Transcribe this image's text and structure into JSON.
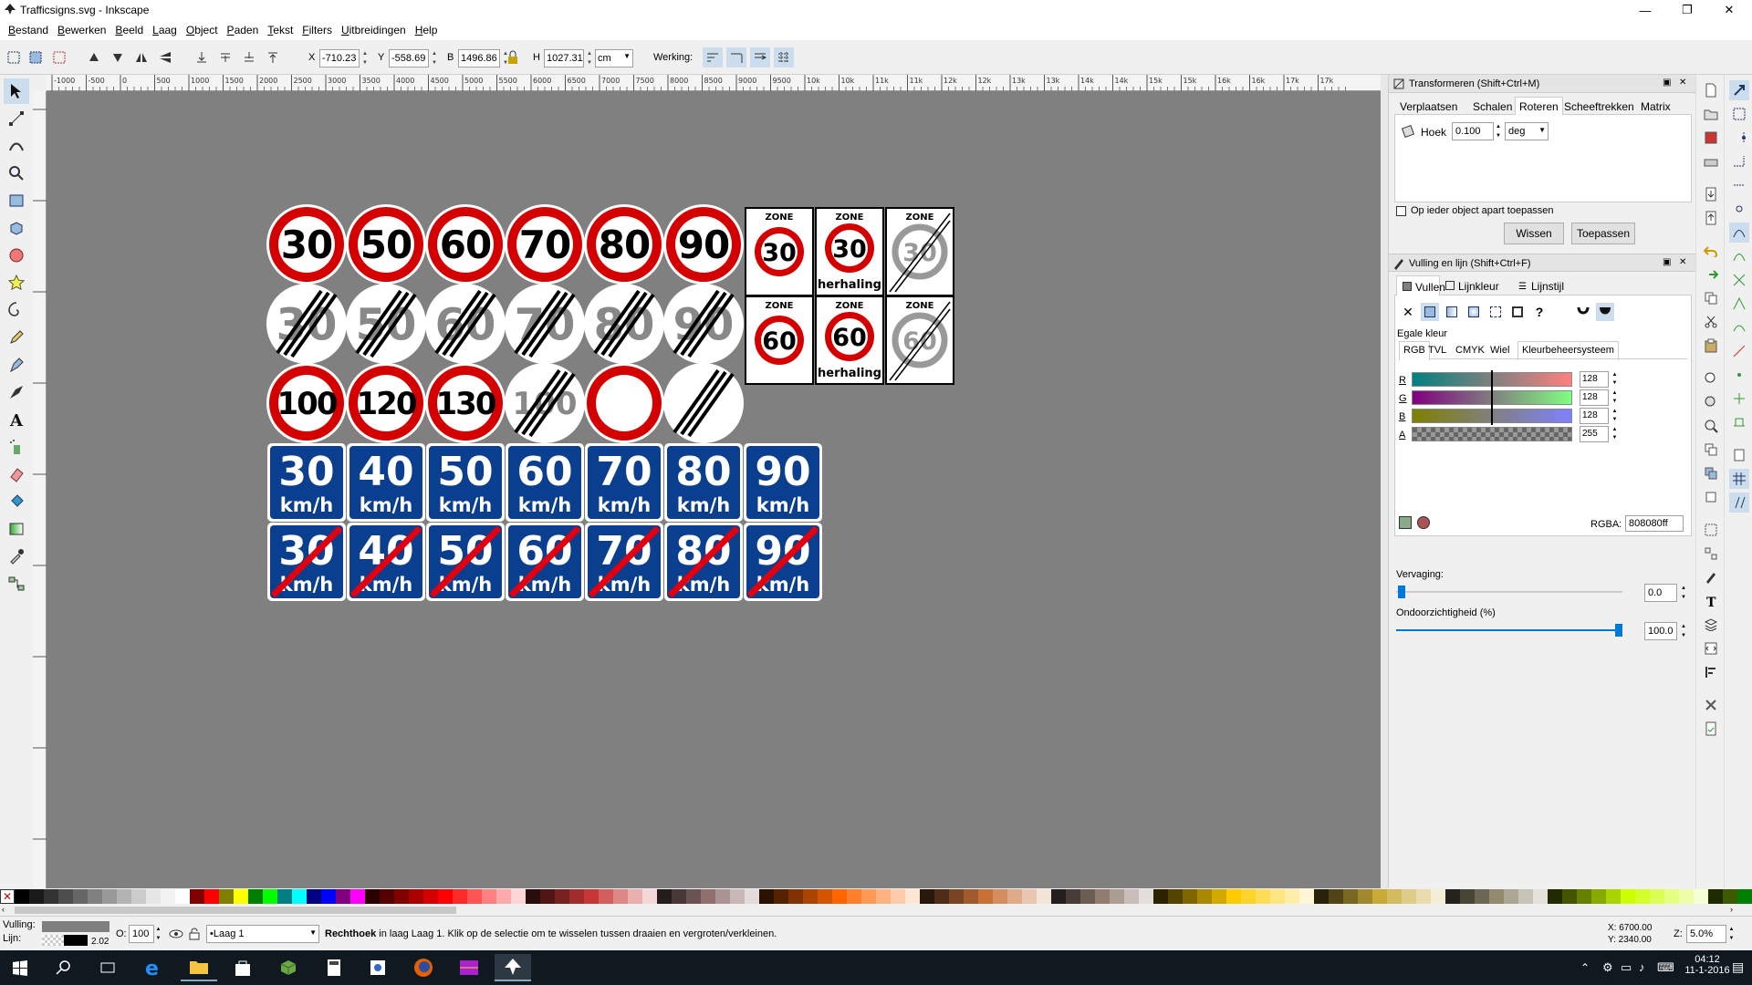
{
  "window": {
    "title": "Trafficsigns.svg - Inkscape",
    "minimize": "—",
    "maximize": "❐",
    "close": "✕"
  },
  "menu": [
    "Bestand",
    "Bewerken",
    "Beeld",
    "Laag",
    "Object",
    "Paden",
    "Tekst",
    "Filters",
    "Uitbreidingen",
    "Help"
  ],
  "toolcontrols": {
    "x_label": "X",
    "x_value": "-710.23",
    "y_label": "Y",
    "y_value": "-558.69",
    "w_label": "B",
    "w_value": "1496.86",
    "h_label": "H",
    "h_value": "1027.31",
    "unit": "cm",
    "affect_label": "Werking:"
  },
  "ruler_top": [
    "-1000",
    "-500",
    "0",
    "500",
    "1000",
    "1500",
    "2000",
    "2500",
    "3000",
    "3500",
    "4000",
    "4500",
    "5000",
    "5500",
    "6000",
    "6500",
    "7000",
    "7500",
    "8000",
    "8500",
    "9000",
    "9500",
    "10k",
    "10k",
    "11k",
    "11k",
    "12k",
    "12k",
    "13k",
    "13k",
    "14k",
    "14k",
    "15k",
    "15k",
    "16k",
    "16k",
    "17k",
    "17k"
  ],
  "signs": {
    "row1": [
      "30",
      "50",
      "60",
      "70",
      "80",
      "90"
    ],
    "row2_ended": [
      "30",
      "50",
      "60",
      "70",
      "80",
      "90"
    ],
    "row3": [
      "100",
      "120",
      "130"
    ],
    "row3_ended": "100",
    "zone_label": "ZONE",
    "zone_row1": [
      {
        "n": "30",
        "sub": ""
      },
      {
        "n": "30",
        "sub": "herhaling"
      },
      {
        "n": "30",
        "sub": "ended"
      }
    ],
    "zone_row2": [
      {
        "n": "60",
        "sub": ""
      },
      {
        "n": "60",
        "sub": "herhaling"
      },
      {
        "n": "60",
        "sub": "ended"
      }
    ],
    "blue_row": [
      "30",
      "40",
      "50",
      "60",
      "70",
      "80",
      "90"
    ],
    "blue_unit": "km/h"
  },
  "transform_panel": {
    "title": "Transformeren (Shift+Ctrl+M)",
    "tabs": [
      "Verplaatsen",
      "Schalen",
      "Roteren",
      "Scheeftrekken",
      "Matrix"
    ],
    "active_tab": "Roteren",
    "angle_label": "Hoek",
    "angle_value": "0.100",
    "angle_unit": "deg",
    "apply_each_label": "Op ieder object apart toepassen",
    "clear_button": "Wissen",
    "apply_button": "Toepassen"
  },
  "fill_panel": {
    "title": "Vulling en lijn (Shift+Ctrl+F)",
    "tabs": [
      "Vullen",
      "Lijnkleur",
      "Lijnstijl"
    ],
    "flat_color_label": "Egale kleur",
    "color_tabs": [
      "RGB",
      "TVL",
      "CMYK",
      "Wiel",
      "Kleurbeheersysteem"
    ],
    "channels": [
      {
        "label": "R",
        "value": "128"
      },
      {
        "label": "G",
        "value": "128"
      },
      {
        "label": "B",
        "value": "128"
      },
      {
        "label": "A",
        "value": "255"
      }
    ],
    "rgba_label": "RGBA:",
    "rgba_value": "808080ff",
    "blur_label": "Vervaging:",
    "blur_value": "0.0",
    "opacity_label": "Ondoorzichtigheid (%)",
    "opacity_value": "100.0",
    "color_current": "#808080"
  },
  "status": {
    "fill_label": "Vulling:",
    "stroke_label": "Lijn:",
    "stroke_width": "2.02",
    "opacity_label": "O:",
    "opacity_value": "100",
    "layer": "•Laag 1",
    "message_bold": "Rechthoek",
    "message_rest": " in laag Laag 1. Klik op de selectie om te wisselen tussen draaien en vergroten/verkleinen.",
    "cursor_x": "X: 6700.00",
    "cursor_y": "Y: 2340.00",
    "zoom_label": "Z:",
    "zoom_value": "5.0%"
  },
  "taskbar": {
    "time": "04:12",
    "date": "11-1-2016"
  },
  "colors": {
    "sign_red": "#d40000",
    "sign_blue": "#0a3f8f",
    "canvas": "#808080"
  }
}
